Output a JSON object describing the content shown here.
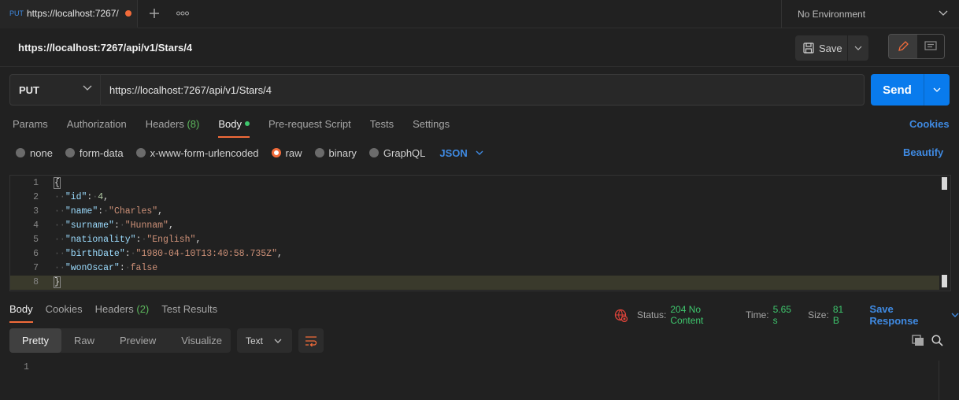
{
  "tab": {
    "method": "PUT",
    "title": "https://localhost:7267/",
    "new_tab_icon": "plus-icon",
    "more_icon": "ellipsis-icon"
  },
  "environment": {
    "label": "No Environment"
  },
  "request": {
    "name": "https://localhost:7267/api/v1/Stars/4",
    "save_label": "Save"
  },
  "url_bar": {
    "method": "PUT",
    "url": "https://localhost:7267/api/v1/Stars/4",
    "send_label": "Send"
  },
  "request_tabs": {
    "params": "Params",
    "authorization": "Authorization",
    "headers": "Headers",
    "headers_count": "(8)",
    "body": "Body",
    "pre_request": "Pre-request Script",
    "tests": "Tests",
    "settings": "Settings",
    "cookies": "Cookies"
  },
  "body_types": {
    "none": "none",
    "form_data": "form-data",
    "urlencoded": "x-www-form-urlencoded",
    "raw": "raw",
    "binary": "binary",
    "graphql": "GraphQL",
    "format": "JSON",
    "beautify": "Beautify"
  },
  "editor": {
    "line_numbers": [
      "1",
      "2",
      "3",
      "4",
      "5",
      "6",
      "7",
      "8"
    ],
    "open_brace": "{",
    "close_brace": "}",
    "fields": [
      {
        "key": "\"id\"",
        "value": "4",
        "comma": ","
      },
      {
        "key": "\"name\"",
        "value": "\"Charles\"",
        "comma": ","
      },
      {
        "key": "\"surname\"",
        "value": "\"Hunnam\"",
        "comma": ","
      },
      {
        "key": "\"nationality\"",
        "value": "\"English\"",
        "comma": ","
      },
      {
        "key": "\"birthDate\"",
        "value": "\"1980-04-10T13:40:58.735Z\"",
        "comma": ","
      },
      {
        "key": "\"wonOscar\"",
        "value": "false",
        "comma": ""
      }
    ]
  },
  "response": {
    "tabs": {
      "body": "Body",
      "cookies": "Cookies",
      "headers": "Headers",
      "headers_count": "(2)",
      "test_results": "Test Results"
    },
    "status_label": "Status:",
    "status_value": "204 No Content",
    "time_label": "Time:",
    "time_value": "5.65 s",
    "size_label": "Size:",
    "size_value": "81 B",
    "save_response": "Save Response",
    "view_modes": {
      "pretty": "Pretty",
      "raw": "Raw",
      "preview": "Preview",
      "visualize": "Visualize"
    },
    "format": "Text",
    "line_number": "1"
  },
  "colors": {
    "accent": "#f26b3a",
    "link": "#3f8ae2",
    "send": "#097bed",
    "success": "#3ec66d"
  }
}
